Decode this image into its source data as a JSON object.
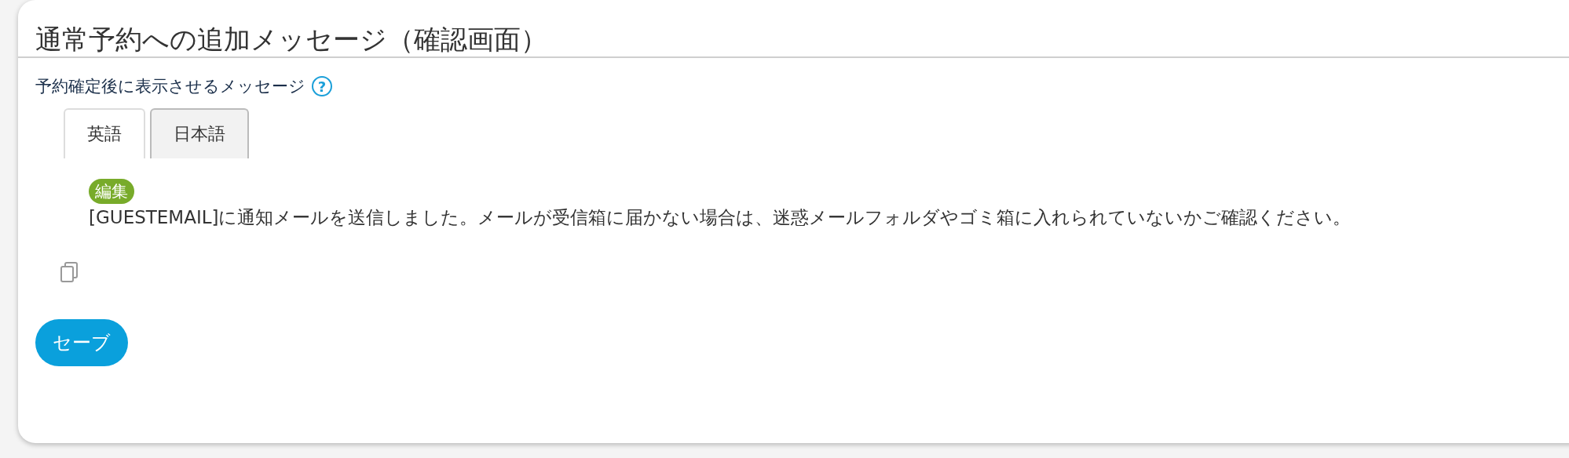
{
  "panel": {
    "title": "通常予約への追加メッセージ（確認画面）"
  },
  "field": {
    "label": "予約確定後に表示させるメッセージ",
    "help": "?"
  },
  "tabs": [
    {
      "label": "英語",
      "selected": true
    },
    {
      "label": "日本語",
      "selected": false
    }
  ],
  "message": {
    "edit_badge": "編集",
    "text": "[GUESTEMAIL]に通知メールを送信しました。メールが受信箱に届かない場合は、迷惑メールフォルダやゴミ箱に入れられていないかご確認ください。"
  },
  "save_button": "セーブ"
}
